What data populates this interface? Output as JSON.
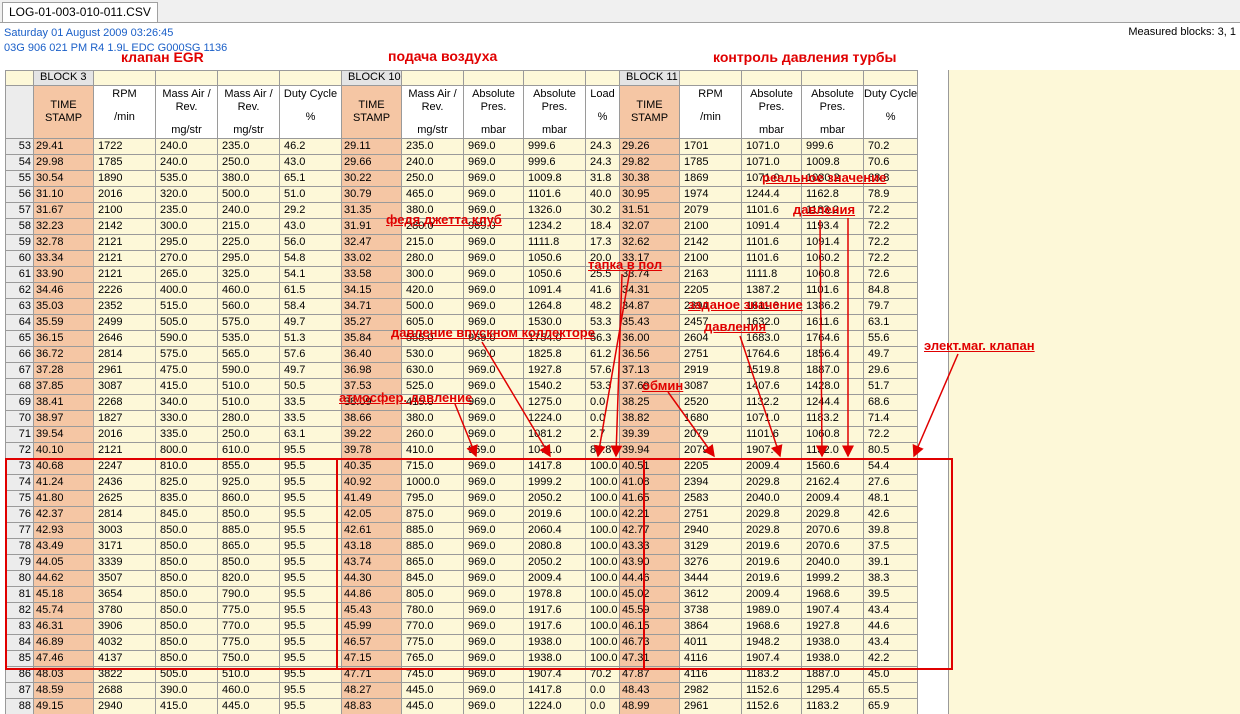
{
  "tab": {
    "label": "LOG-01-003-010-011.CSV"
  },
  "info": {
    "date": "Saturday 01 August 2009 03:26:45",
    "ecu": "03G 906 021 PM  R4 1.9L EDC G000SG  1136"
  },
  "measured": "Measured blocks: 3, 1",
  "blocks": [
    "BLOCK 3",
    "BLOCK 10",
    "BLOCK 11"
  ],
  "headers": [
    {
      "l1": "TIME",
      "l2": "STAMP",
      "unit": ""
    },
    {
      "l1": "RPM",
      "l2": "",
      "unit": "/min"
    },
    {
      "l1": "Mass Air /",
      "l2": "Rev.",
      "unit": "mg/str"
    },
    {
      "l1": "Mass Air /",
      "l2": "Rev.",
      "unit": "mg/str"
    },
    {
      "l1": "Duty Cycle",
      "l2": "",
      "unit": "%"
    },
    {
      "l1": "TIME",
      "l2": "STAMP",
      "unit": ""
    },
    {
      "l1": "Mass Air /",
      "l2": "Rev.",
      "unit": "mg/str"
    },
    {
      "l1": "Absolute",
      "l2": "Pres.",
      "unit": "mbar"
    },
    {
      "l1": "Absolute",
      "l2": "Pres.",
      "unit": "mbar"
    },
    {
      "l1": "Load",
      "l2": "",
      "unit": "%"
    },
    {
      "l1": "TIME",
      "l2": "STAMP",
      "unit": ""
    },
    {
      "l1": "RPM",
      "l2": "",
      "unit": "/min"
    },
    {
      "l1": "Absolute",
      "l2": "Pres.",
      "unit": "mbar"
    },
    {
      "l1": "Absolute",
      "l2": "Pres.",
      "unit": "mbar"
    },
    {
      "l1": "Duty Cycle",
      "l2": "",
      "unit": "%"
    }
  ],
  "rows": [
    [
      "53",
      "29.41",
      "1722",
      "240.0",
      "235.0",
      "46.2",
      "29.11",
      "235.0",
      "969.0",
      "999.6",
      "24.3",
      "29.26",
      "1701",
      "1071.0",
      "999.6",
      "70.2"
    ],
    [
      "54",
      "29.98",
      "1785",
      "240.0",
      "250.0",
      "43.0",
      "29.66",
      "240.0",
      "969.0",
      "999.6",
      "24.3",
      "29.82",
      "1785",
      "1071.0",
      "1009.8",
      "70.6"
    ],
    [
      "55",
      "30.54",
      "1890",
      "535.0",
      "380.0",
      "65.1",
      "30.22",
      "250.0",
      "969.0",
      "1009.8",
      "31.8",
      "30.38",
      "1869",
      "1071.0",
      "1030.2",
      "68.8"
    ],
    [
      "56",
      "31.10",
      "2016",
      "320.0",
      "500.0",
      "51.0",
      "30.79",
      "465.0",
      "969.0",
      "1101.6",
      "40.0",
      "30.95",
      "1974",
      "1244.4",
      "1162.8",
      "78.9"
    ],
    [
      "57",
      "31.67",
      "2100",
      "235.0",
      "240.0",
      "29.2",
      "31.35",
      "380.0",
      "969.0",
      "1326.0",
      "30.2",
      "31.51",
      "2079",
      "1101.6",
      "1183.2",
      "72.2"
    ],
    [
      "58",
      "32.23",
      "2142",
      "300.0",
      "215.0",
      "43.0",
      "31.91",
      "280.0",
      "969.0",
      "1234.2",
      "18.4",
      "32.07",
      "2100",
      "1091.4",
      "1193.4",
      "72.2"
    ],
    [
      "59",
      "32.78",
      "2121",
      "295.0",
      "225.0",
      "56.0",
      "32.47",
      "215.0",
      "969.0",
      "1111.8",
      "17.3",
      "32.62",
      "2142",
      "1101.6",
      "1091.4",
      "72.2"
    ],
    [
      "60",
      "33.34",
      "2121",
      "270.0",
      "295.0",
      "54.8",
      "33.02",
      "280.0",
      "969.0",
      "1050.6",
      "20.0",
      "33.17",
      "2100",
      "1101.6",
      "1060.2",
      "72.2"
    ],
    [
      "61",
      "33.90",
      "2121",
      "265.0",
      "325.0",
      "54.1",
      "33.58",
      "300.0",
      "969.0",
      "1050.6",
      "25.5",
      "33.74",
      "2163",
      "1111.8",
      "1060.8",
      "72.6"
    ],
    [
      "62",
      "34.46",
      "2226",
      "400.0",
      "460.0",
      "61.5",
      "34.15",
      "420.0",
      "969.0",
      "1091.4",
      "41.6",
      "34.31",
      "2205",
      "1387.2",
      "1101.6",
      "84.8"
    ],
    [
      "63",
      "35.03",
      "2352",
      "515.0",
      "560.0",
      "58.4",
      "34.71",
      "500.0",
      "969.0",
      "1264.8",
      "48.2",
      "34.87",
      "2394",
      "1611.6",
      "1386.2",
      "79.7"
    ],
    [
      "64",
      "35.59",
      "2499",
      "505.0",
      "575.0",
      "49.7",
      "35.27",
      "605.0",
      "969.0",
      "1530.0",
      "53.3",
      "35.43",
      "2457",
      "1632.0",
      "1611.6",
      "63.1"
    ],
    [
      "65",
      "36.15",
      "2646",
      "590.0",
      "535.0",
      "51.3",
      "35.84",
      "555.0",
      "969.0",
      "1754.0",
      "56.3",
      "36.00",
      "2604",
      "1683.0",
      "1764.6",
      "55.6"
    ],
    [
      "66",
      "36.72",
      "2814",
      "575.0",
      "565.0",
      "57.6",
      "36.40",
      "530.0",
      "969.0",
      "1825.8",
      "61.2",
      "36.56",
      "2751",
      "1764.6",
      "1856.4",
      "49.7"
    ],
    [
      "67",
      "37.28",
      "2961",
      "475.0",
      "590.0",
      "49.7",
      "36.98",
      "630.0",
      "969.0",
      "1927.8",
      "57.6",
      "37.13",
      "2919",
      "1519.8",
      "1887.0",
      "29.6"
    ],
    [
      "68",
      "37.85",
      "3087",
      "415.0",
      "510.0",
      "50.5",
      "37.53",
      "525.0",
      "969.0",
      "1540.2",
      "53.3",
      "37.69",
      "3087",
      "1407.6",
      "1428.0",
      "51.7"
    ],
    [
      "69",
      "38.41",
      "2268",
      "340.0",
      "510.0",
      "33.5",
      "38.09",
      "415.0",
      "969.0",
      "1275.0",
      "0.0",
      "38.25",
      "2520",
      "1132.2",
      "1244.4",
      "68.6"
    ],
    [
      "70",
      "38.97",
      "1827",
      "330.0",
      "280.0",
      "33.5",
      "38.66",
      "380.0",
      "969.0",
      "1224.0",
      "0.0",
      "38.82",
      "1680",
      "1071.0",
      "1183.2",
      "71.4"
    ],
    [
      "71",
      "39.54",
      "2016",
      "335.0",
      "250.0",
      "63.1",
      "39.22",
      "260.0",
      "969.0",
      "1081.2",
      "2.7",
      "39.39",
      "2079",
      "1101.6",
      "1060.8",
      "72.2"
    ],
    [
      "72",
      "40.10",
      "2121",
      "800.0",
      "610.0",
      "95.5",
      "39.78",
      "410.0",
      "969.0",
      "1071.0",
      "87.8",
      "39.94",
      "2079",
      "1907.4",
      "1132.0",
      "80.5"
    ],
    [
      "73",
      "40.68",
      "2247",
      "810.0",
      "855.0",
      "95.5",
      "40.35",
      "715.0",
      "969.0",
      "1417.8",
      "100.0",
      "40.51",
      "2205",
      "2009.4",
      "1560.6",
      "54.4"
    ],
    [
      "74",
      "41.24",
      "2436",
      "825.0",
      "925.0",
      "95.5",
      "40.92",
      "1000.0",
      "969.0",
      "1999.2",
      "100.0",
      "41.08",
      "2394",
      "2029.8",
      "2162.4",
      "27.6"
    ],
    [
      "75",
      "41.80",
      "2625",
      "835.0",
      "860.0",
      "95.5",
      "41.49",
      "795.0",
      "969.0",
      "2050.2",
      "100.0",
      "41.65",
      "2583",
      "2040.0",
      "2009.4",
      "48.1"
    ],
    [
      "76",
      "42.37",
      "2814",
      "845.0",
      "850.0",
      "95.5",
      "42.05",
      "875.0",
      "969.0",
      "2019.6",
      "100.0",
      "42.21",
      "2751",
      "2029.8",
      "2029.8",
      "42.6"
    ],
    [
      "77",
      "42.93",
      "3003",
      "850.0",
      "885.0",
      "95.5",
      "42.61",
      "885.0",
      "969.0",
      "2060.4",
      "100.0",
      "42.77",
      "2940",
      "2029.8",
      "2070.6",
      "39.8"
    ],
    [
      "78",
      "43.49",
      "3171",
      "850.0",
      "865.0",
      "95.5",
      "43.18",
      "885.0",
      "969.0",
      "2080.8",
      "100.0",
      "43.33",
      "3129",
      "2019.6",
      "2070.6",
      "37.5"
    ],
    [
      "79",
      "44.05",
      "3339",
      "850.0",
      "850.0",
      "95.5",
      "43.74",
      "865.0",
      "969.0",
      "2050.2",
      "100.0",
      "43.90",
      "3276",
      "2019.6",
      "2040.0",
      "39.1"
    ],
    [
      "80",
      "44.62",
      "3507",
      "850.0",
      "820.0",
      "95.5",
      "44.30",
      "845.0",
      "969.0",
      "2009.4",
      "100.0",
      "44.46",
      "3444",
      "2019.6",
      "1999.2",
      "38.3"
    ],
    [
      "81",
      "45.18",
      "3654",
      "850.0",
      "790.0",
      "95.5",
      "44.86",
      "805.0",
      "969.0",
      "1978.8",
      "100.0",
      "45.02",
      "3612",
      "2009.4",
      "1968.6",
      "39.5"
    ],
    [
      "82",
      "45.74",
      "3780",
      "850.0",
      "775.0",
      "95.5",
      "45.43",
      "780.0",
      "969.0",
      "1917.6",
      "100.0",
      "45.59",
      "3738",
      "1989.0",
      "1907.4",
      "43.4"
    ],
    [
      "83",
      "46.31",
      "3906",
      "850.0",
      "770.0",
      "95.5",
      "45.99",
      "770.0",
      "969.0",
      "1917.6",
      "100.0",
      "46.15",
      "3864",
      "1968.6",
      "1927.8",
      "44.6"
    ],
    [
      "84",
      "46.89",
      "4032",
      "850.0",
      "775.0",
      "95.5",
      "46.57",
      "775.0",
      "969.0",
      "1938.0",
      "100.0",
      "46.73",
      "4011",
      "1948.2",
      "1938.0",
      "43.4"
    ],
    [
      "85",
      "47.46",
      "4137",
      "850.0",
      "750.0",
      "95.5",
      "47.15",
      "765.0",
      "969.0",
      "1938.0",
      "100.0",
      "47.31",
      "4116",
      "1907.4",
      "1938.0",
      "42.2"
    ],
    [
      "86",
      "48.03",
      "3822",
      "505.0",
      "510.0",
      "95.5",
      "47.71",
      "745.0",
      "969.0",
      "1907.4",
      "70.2",
      "47.87",
      "4116",
      "1183.2",
      "1887.0",
      "45.0"
    ],
    [
      "87",
      "48.59",
      "2688",
      "390.0",
      "460.0",
      "95.5",
      "48.27",
      "445.0",
      "969.0",
      "1417.8",
      "0.0",
      "48.43",
      "2982",
      "1152.6",
      "1295.4",
      "65.5"
    ],
    [
      "88",
      "49.15",
      "2940",
      "415.0",
      "445.0",
      "95.5",
      "48.83",
      "445.0",
      "969.0",
      "1224.0",
      "0.0",
      "48.99",
      "2961",
      "1152.6",
      "1183.2",
      "65.9"
    ]
  ],
  "annotations": {
    "egr": "клапан EGR",
    "air_supply": "подача воздуха",
    "turbo_ctrl": "контроль давления турбы",
    "fedya": "федя джетта клуб",
    "pedal": "тапка в пол",
    "actual_1": "реальное значение",
    "actual_2": "давления",
    "setpoint_1": "заданое значение",
    "setpoint_2": "давления",
    "intake": "давление впускном коллекторе",
    "solenoid": "элект.маг. клапан",
    "rpm": "обмин",
    "atm": "атмосфер. давление"
  }
}
